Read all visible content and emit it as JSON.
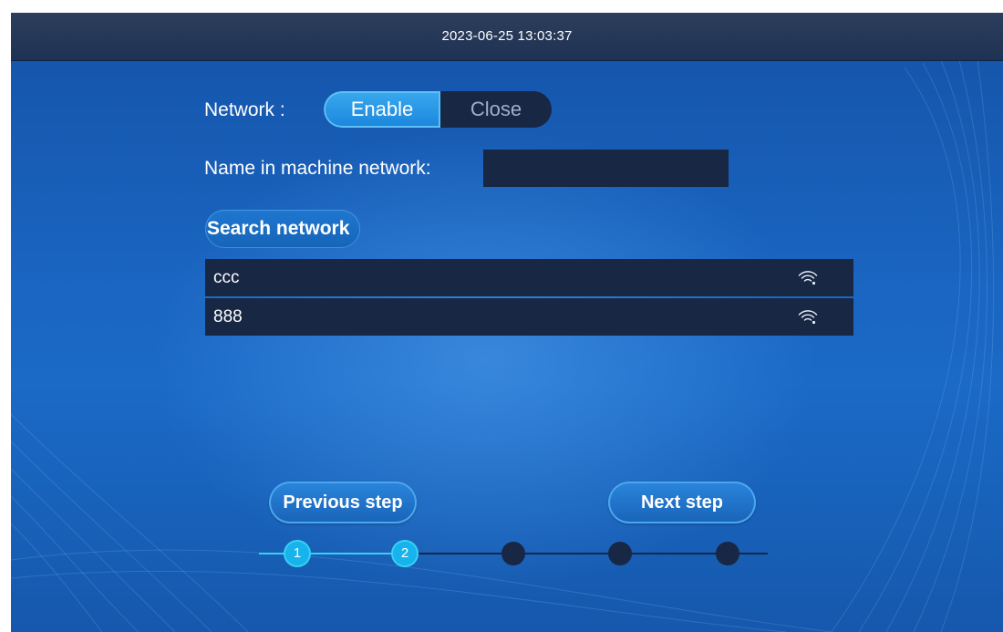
{
  "topbar": {
    "datetime": "2023-06-25 13:03:37"
  },
  "network": {
    "label": "Network :",
    "enable_label": "Enable",
    "close_label": "Close",
    "selected": "Enable"
  },
  "machine_name": {
    "label": "Name in machine network:",
    "value": "",
    "placeholder": ""
  },
  "search": {
    "button_label": "Search network"
  },
  "networks": [
    {
      "ssid": "ccc",
      "icon": "wifi-signal-icon"
    },
    {
      "ssid": "888",
      "icon": "wifi-signal-icon"
    }
  ],
  "navigation": {
    "previous_label": "Previous step",
    "next_label": "Next step"
  },
  "stepper": {
    "current_step": 2,
    "total_steps": 5,
    "steps": [
      {
        "label": "1",
        "status": "done"
      },
      {
        "label": "2",
        "status": "current"
      },
      {
        "label": "",
        "status": "todo"
      },
      {
        "label": "",
        "status": "todo"
      },
      {
        "label": "",
        "status": "todo"
      }
    ]
  },
  "colors": {
    "background": "#1a66c2",
    "topbar": "#24385a",
    "panel": "#172744",
    "accent": "#16b3ec",
    "button": "#1f77cf"
  }
}
